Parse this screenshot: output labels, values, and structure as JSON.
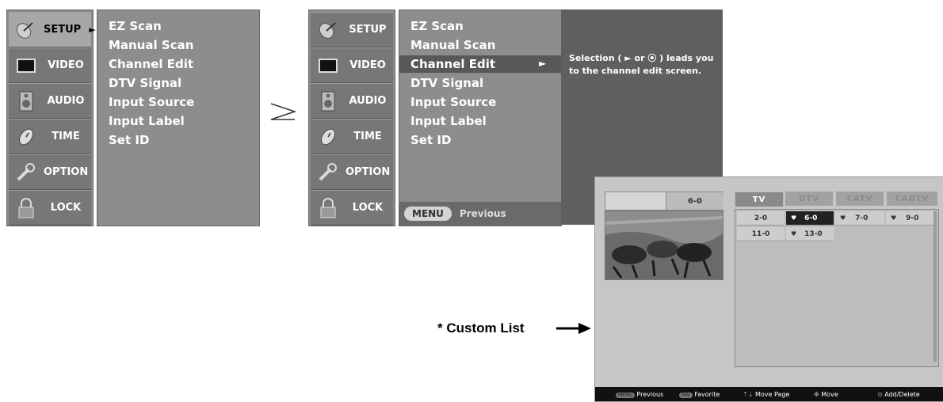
{
  "menu": [
    {
      "label": "SETUP",
      "icon": "satellite-dish-icon"
    },
    {
      "label": "VIDEO",
      "icon": "monitor-icon"
    },
    {
      "label": "AUDIO",
      "icon": "speaker-icon"
    },
    {
      "label": "TIME",
      "icon": "clock-icon"
    },
    {
      "label": "OPTION",
      "icon": "wrench-icon"
    },
    {
      "label": "LOCK",
      "icon": "padlock-icon"
    }
  ],
  "arrow_right": "►",
  "submenu": [
    "EZ Scan",
    "Manual Scan",
    "Channel Edit",
    "DTV Signal",
    "Input Source",
    "Input Label",
    "Set ID"
  ],
  "step_arrow": "≥",
  "description": "Selection ( ► or ⦿ ) leads you to the channel edit screen.",
  "menu_button": "MENU",
  "previous": "Previous",
  "custom_list_label": "* Custom List",
  "channel_edit": {
    "current_channel": "6-0",
    "tabs": [
      "TV",
      "DTV",
      "CATV",
      "CADTV"
    ],
    "rows": [
      [
        {
          "ch": "2-0",
          "fav": false
        },
        {
          "ch": "6-0",
          "fav": true,
          "selected": true
        },
        {
          "ch": "7-0",
          "fav": true
        },
        {
          "ch": "9-0",
          "fav": true
        }
      ],
      [
        {
          "ch": "11-0",
          "fav": false
        },
        {
          "ch": "13-0",
          "fav": true
        }
      ]
    ],
    "help": [
      "Previous",
      "Favorite",
      "Move Page",
      "Move",
      "Add/Delete"
    ],
    "help_keys": [
      "MENU",
      "FAV"
    ]
  }
}
